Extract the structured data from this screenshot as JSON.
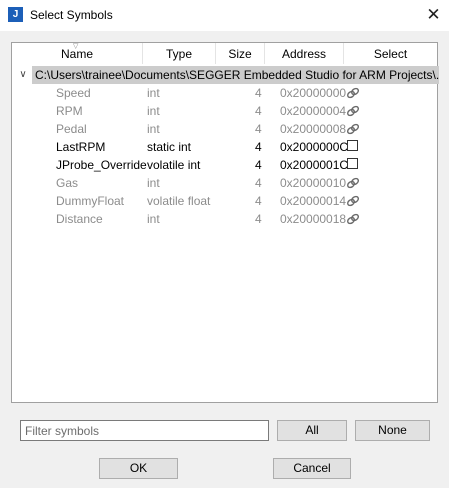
{
  "window": {
    "title": "Select Symbols",
    "app_icon_glyph": "J",
    "close_glyph": "✕"
  },
  "tree": {
    "columns": [
      {
        "label": "Name"
      },
      {
        "label": "Type"
      },
      {
        "label": "Size"
      },
      {
        "label": "Address"
      },
      {
        "label": "Select"
      }
    ],
    "root": {
      "expander_glyph": "∨",
      "path": "C:\\Users\\trainee\\Documents\\SEGGER Embedded Studio for ARM Projects\\..."
    },
    "rows": [
      {
        "name": "Speed",
        "type": "int",
        "size": "4",
        "address": "0x20000000",
        "select": "link-icon",
        "style": "gray"
      },
      {
        "name": "RPM",
        "type": "int",
        "size": "4",
        "address": "0x20000004",
        "select": "link-icon",
        "style": "gray"
      },
      {
        "name": "Pedal",
        "type": "int",
        "size": "4",
        "address": "0x20000008",
        "select": "link-icon",
        "style": "gray"
      },
      {
        "name": "LastRPM",
        "type": "static int",
        "size": "4",
        "address": "0x2000000C",
        "select": "checkbox",
        "checked": false,
        "style": "black"
      },
      {
        "name": "JProbe_Override",
        "type": "volatile int",
        "size": "4",
        "address": "0x2000001C",
        "select": "checkbox",
        "checked": false,
        "style": "black"
      },
      {
        "name": "Gas",
        "type": "int",
        "size": "4",
        "address": "0x20000010",
        "select": "link-icon",
        "style": "gray"
      },
      {
        "name": "DummyFloat",
        "type": "volatile float",
        "size": "4",
        "address": "0x20000014",
        "select": "link-icon",
        "style": "gray"
      },
      {
        "name": "Distance",
        "type": "int",
        "size": "4",
        "address": "0x20000018",
        "select": "link-icon",
        "style": "gray"
      }
    ]
  },
  "filter": {
    "placeholder": "Filter symbols",
    "value": ""
  },
  "buttons": {
    "all": "All",
    "none": "None",
    "ok": "OK",
    "cancel": "Cancel"
  },
  "colors": {
    "root_highlight": "#cccccc",
    "disabled_text": "#8c8c8c",
    "app_icon": "#1c5fb8"
  }
}
